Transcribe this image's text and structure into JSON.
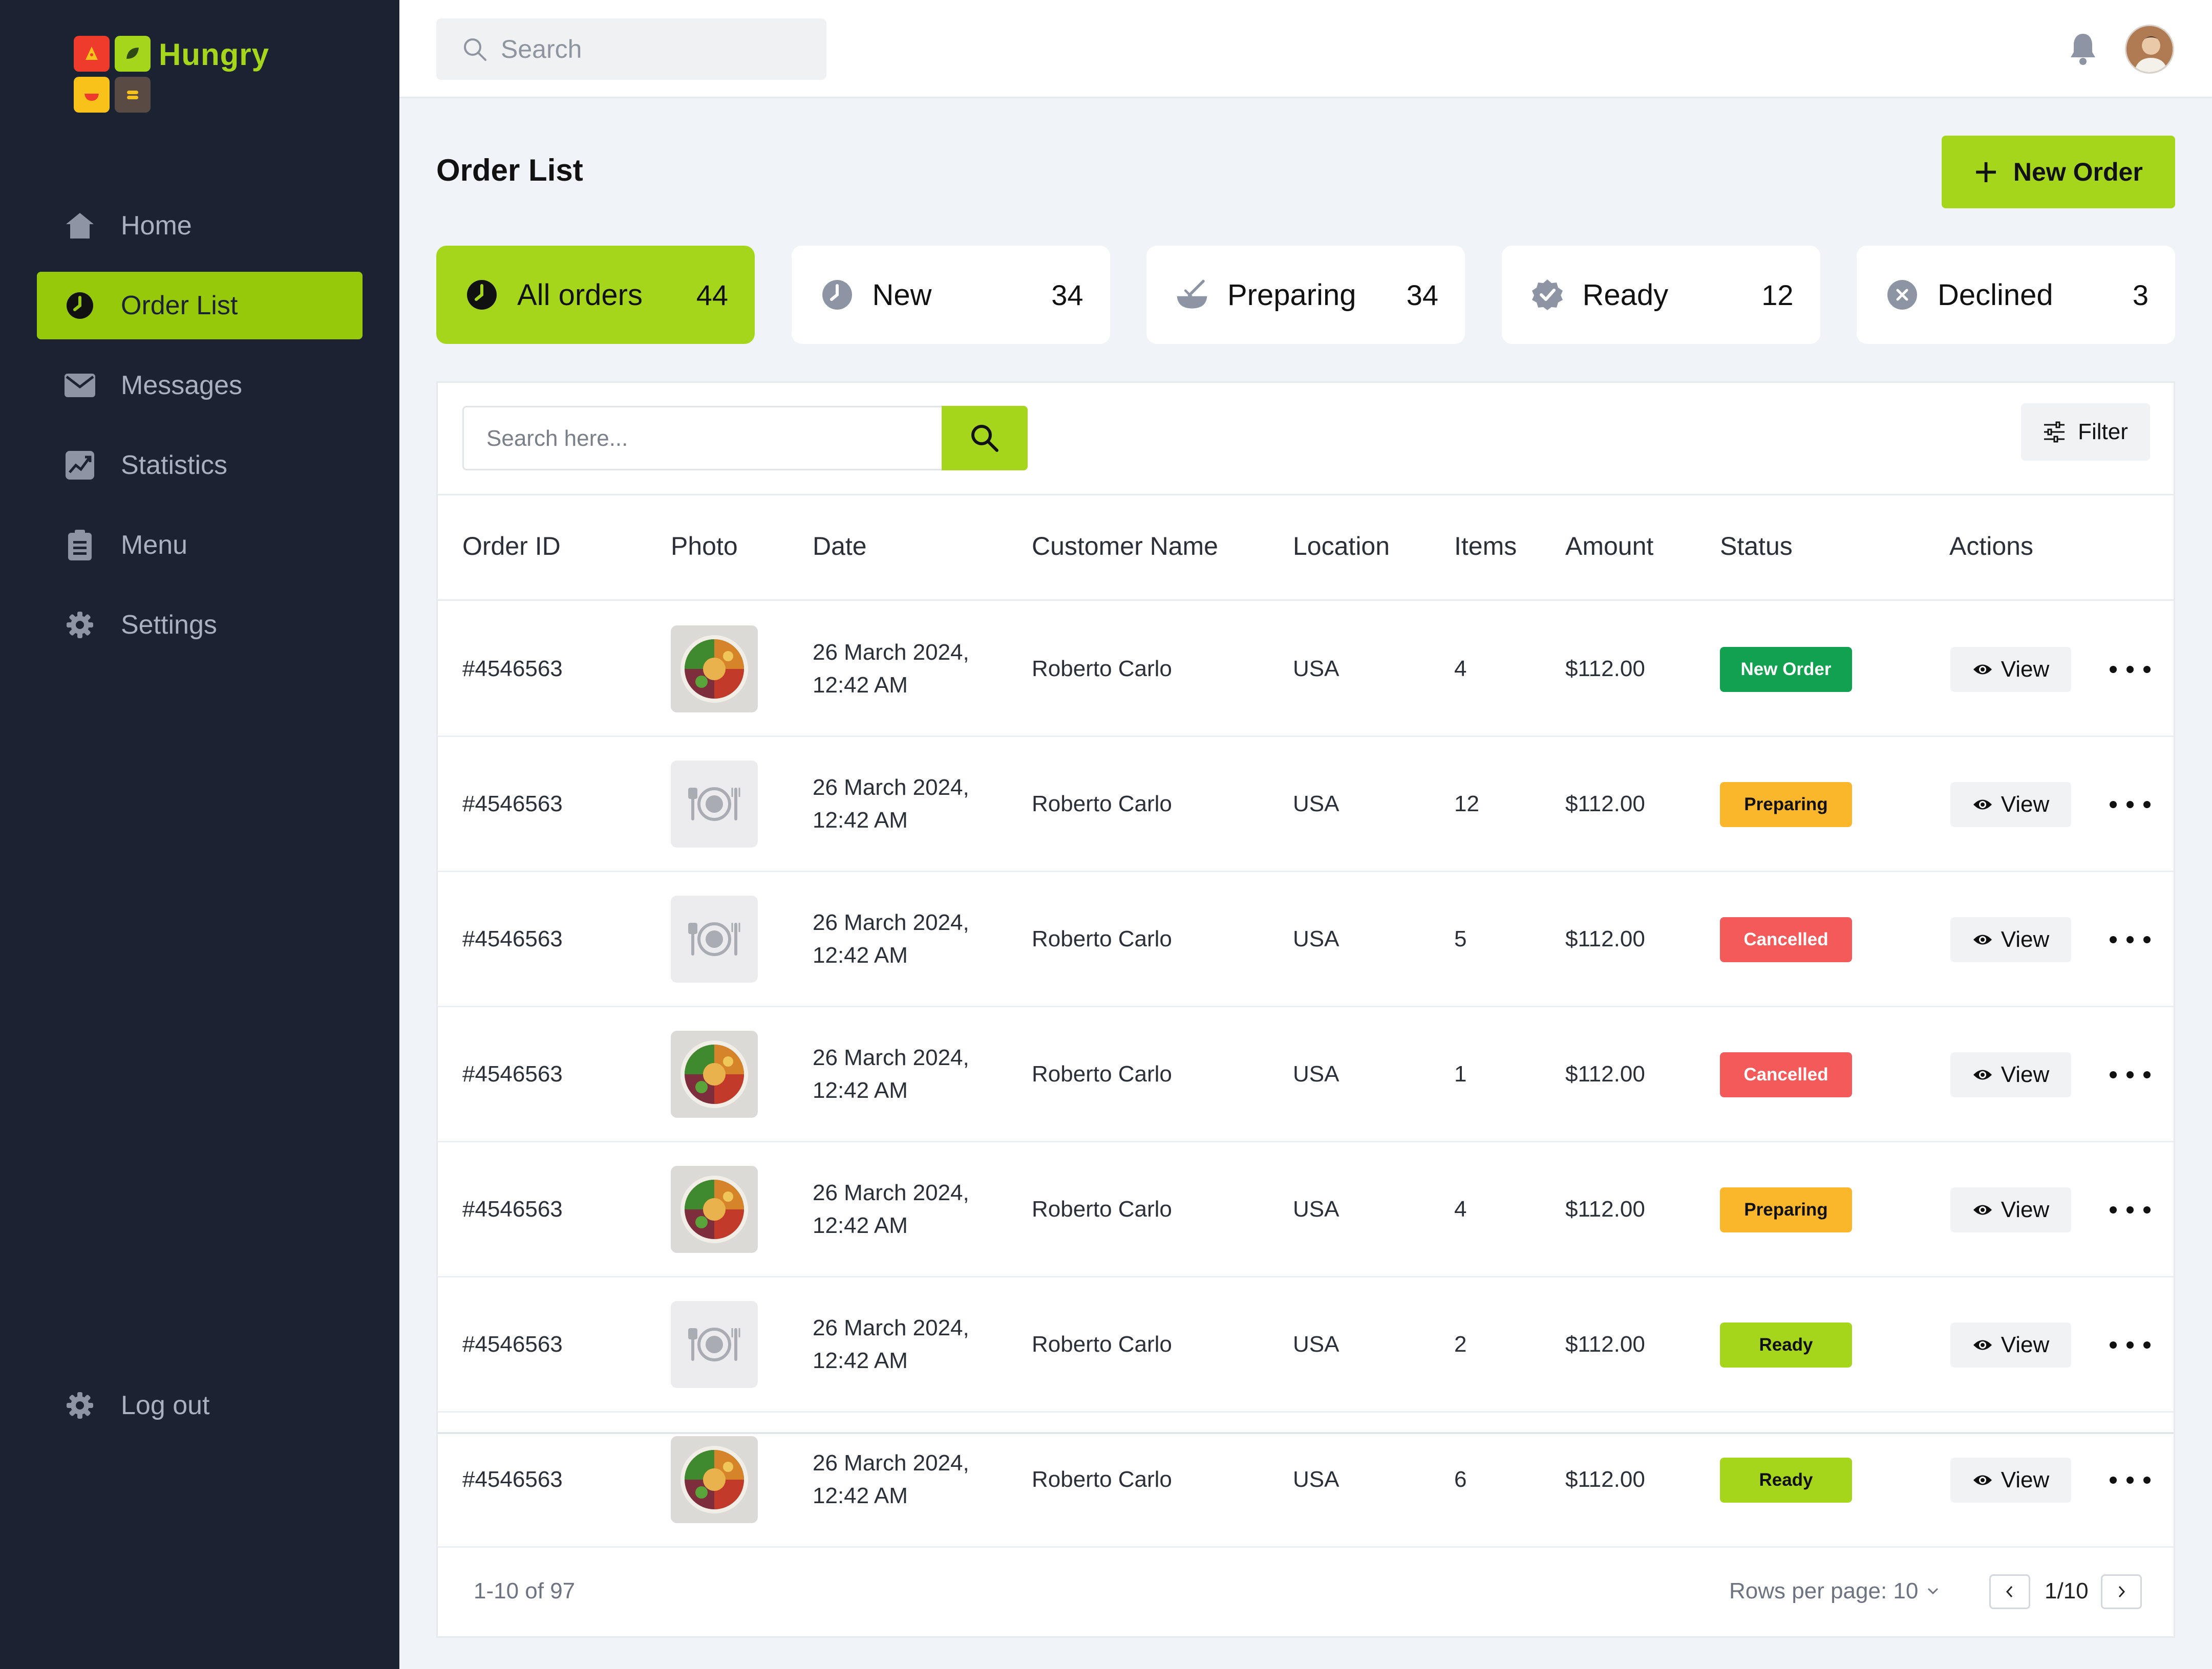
{
  "app": {
    "name": "Hungry"
  },
  "sidebar": {
    "items": [
      {
        "label": "Home",
        "icon": "home-icon"
      },
      {
        "label": "Order List",
        "icon": "clock-icon"
      },
      {
        "label": "Messages",
        "icon": "mail-icon"
      },
      {
        "label": "Statistics",
        "icon": "chart-icon"
      },
      {
        "label": "Menu",
        "icon": "clipboard-icon"
      },
      {
        "label": "Settings",
        "icon": "gear-icon"
      }
    ],
    "active": "Order List",
    "logout": {
      "label": "Log out",
      "icon": "gear-icon"
    }
  },
  "topbar": {
    "search_placeholder": "Search"
  },
  "header": {
    "title": "Order List",
    "new_order_label": "New Order"
  },
  "tabs": [
    {
      "label": "All orders",
      "count": "44",
      "icon": "clock-icon"
    },
    {
      "label": "New",
      "count": "34",
      "icon": "clock-icon"
    },
    {
      "label": "Preparing",
      "count": "34",
      "icon": "cooking-pot-icon"
    },
    {
      "label": "Ready",
      "count": "12",
      "icon": "verified-badge-icon"
    },
    {
      "label": "Declined",
      "count": "3",
      "icon": "x-circle-icon"
    }
  ],
  "table": {
    "search_placeholder": "Search here...",
    "filter_label": "Filter",
    "columns": [
      "Order ID",
      "Photo",
      "Date",
      "Customer Name",
      "Location",
      "Items",
      "Amount",
      "Status",
      "Actions"
    ],
    "view_label": "View",
    "rows": [
      {
        "id": "#4546563",
        "photo": "food",
        "date1": "26 March 2024,",
        "date2": "12:42 AM",
        "customer": "Roberto Carlo",
        "location": "USA",
        "items": "4",
        "amount": "$112.00",
        "status": "New Order"
      },
      {
        "id": "#4546563",
        "photo": "placeholder",
        "date1": "26 March 2024,",
        "date2": "12:42 AM",
        "customer": "Roberto Carlo",
        "location": "USA",
        "items": "12",
        "amount": "$112.00",
        "status": "Preparing"
      },
      {
        "id": "#4546563",
        "photo": "placeholder",
        "date1": "26 March 2024,",
        "date2": "12:42 AM",
        "customer": "Roberto Carlo",
        "location": "USA",
        "items": "5",
        "amount": "$112.00",
        "status": "Cancelled"
      },
      {
        "id": "#4546563",
        "photo": "food",
        "date1": "26 March 2024,",
        "date2": "12:42 AM",
        "customer": "Roberto Carlo",
        "location": "USA",
        "items": "1",
        "amount": "$112.00",
        "status": "Cancelled"
      },
      {
        "id": "#4546563",
        "photo": "food",
        "date1": "26 March 2024,",
        "date2": "12:42 AM",
        "customer": "Roberto Carlo",
        "location": "USA",
        "items": "4",
        "amount": "$112.00",
        "status": "Preparing"
      },
      {
        "id": "#4546563",
        "photo": "placeholder",
        "date1": "26 March 2024,",
        "date2": "12:42 AM",
        "customer": "Roberto Carlo",
        "location": "USA",
        "items": "2",
        "amount": "$112.00",
        "status": "Ready"
      },
      {
        "id": "#4546563",
        "photo": "food",
        "date1": "26 March 2024,",
        "date2": "12:42 AM",
        "customer": "Roberto Carlo",
        "location": "USA",
        "items": "6",
        "amount": "$112.00",
        "status": "Ready"
      }
    ]
  },
  "pagination": {
    "range": "1-10 of 97",
    "rows_per_page": "Rows per page: 10",
    "page": "1/10"
  },
  "colors": {
    "accent": "#a6d61c",
    "sidebar_bg": "#1b2333",
    "status_new_order": "#12a150",
    "status_preparing": "#fbb72c",
    "status_cancelled": "#f55a5a",
    "status_ready": "#a6d61c"
  }
}
